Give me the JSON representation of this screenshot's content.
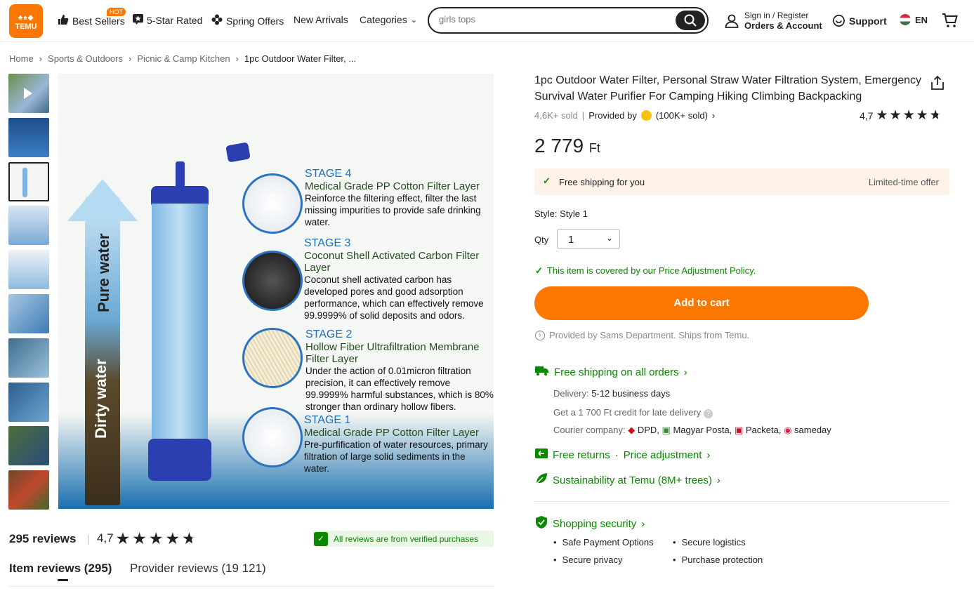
{
  "header": {
    "logo_text": "TEMU",
    "hot_badge": "HOT",
    "nav": [
      "Best Sellers",
      "5-Star Rated",
      "Spring Offers",
      "New Arrivals",
      "Categories"
    ],
    "search_value": "girls tops",
    "sign_in": "Sign in / Register",
    "orders": "Orders & Account",
    "support": "Support",
    "lang": "EN"
  },
  "breadcrumb": [
    "Home",
    "Sports & Outdoors",
    "Picnic & Camp Kitchen",
    "1pc Outdoor Water Filter, ..."
  ],
  "image": {
    "pure_label": "Pure water",
    "dirty_label": "Dirty water",
    "stages": [
      {
        "head": "STAGE 4",
        "title": "Medical Grade PP Cotton Filter Layer",
        "desc": "Reinforce the filtering effect, filter the last missing impurities to provide safe drinking water."
      },
      {
        "head": "STAGE 3",
        "title": "Coconut Shell Activated Carbon Filter Layer",
        "desc": "Coconut shell activated carbon has developed pores and good adsorption performance, which can effectively remove 99.9999% of solid deposits and odors."
      },
      {
        "head": "STAGE 2",
        "title": "Hollow Fiber Ultrafiltration Membrane Filter Layer",
        "desc": "Under the action of 0.01micron filtration precision, it can effectively remove 99.9999% harmful substances, which is 80% stronger than ordinary hollow fibers."
      },
      {
        "head": "STAGE 1",
        "title": "Medical Grade PP Cotton Filter Layer",
        "desc": "Pre-purfification of water resources, primary filtration of large solid sediments in the water."
      }
    ]
  },
  "product": {
    "title": "1pc Outdoor Water Filter, Personal Straw Water Filtration System, Emergency Survival Water Purifier For Camping Hiking Climbing Backpacking",
    "sold": "4,6K+ sold",
    "provided_by": "Provided by",
    "provider_sold": "(100K+ sold)",
    "rating": "4,7",
    "rating_value": 4.7,
    "price": "2 779",
    "currency": "Ft",
    "free_ship": "Free shipping for you",
    "limited": "Limited-time offer",
    "style_label": "Style:",
    "style_value": "Style 1",
    "qty_label": "Qty",
    "qty_value": "1",
    "policy": "This item is covered by our Price Adjustment Policy.",
    "add_to_cart": "Add to cart",
    "provided_note": "Provided by Sams Department. Ships from Temu."
  },
  "shipping": {
    "free_all": "Free shipping on all orders",
    "delivery_label": "Delivery:",
    "delivery_value": "5-12 business days",
    "credit": "Get a 1 700 Ft credit for late delivery",
    "courier_label": "Courier company:",
    "couriers": [
      "DPD,",
      "Magyar Posta,",
      "Packeta,",
      "sameday"
    ],
    "returns": "Free returns",
    "price_adj": "Price adjustment",
    "sustain": "Sustainability at Temu (8M+ trees)",
    "security": "Shopping security",
    "security_items": [
      "Safe Payment Options",
      "Secure logistics",
      "Secure privacy",
      "Purchase protection"
    ]
  },
  "reviews": {
    "count": "295 reviews",
    "rating": "4,7",
    "verified": "All reviews are from verified purchases",
    "tab_item": "Item reviews (295)",
    "tab_provider": "Provider reviews (19 121)"
  },
  "colors": {
    "accent": "#fb7701",
    "green": "#0a8800",
    "ship_bg": "#fef2e9"
  }
}
